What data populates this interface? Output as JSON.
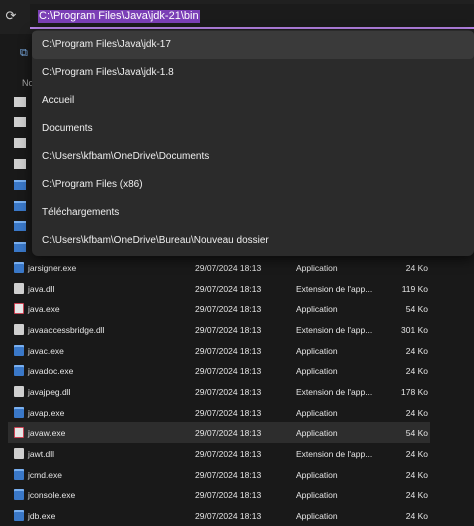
{
  "address_bar": {
    "path": "C:\\Program Files\\Java\\jdk-21\\bin"
  },
  "column_header_partial": "No",
  "suggestions": [
    "C:\\Program Files\\Java\\jdk-17",
    "C:\\Program Files\\Java\\jdk-1.8",
    "Accueil",
    "Documents",
    "C:\\Users\\kfbam\\OneDrive\\Documents",
    "C:\\Program Files (x86)",
    "Téléchargements",
    "C:\\Users\\kfbam\\OneDrive\\Bureau\\Nouveau dossier"
  ],
  "files": [
    {
      "name": "jarsigner.exe",
      "date": "29/07/2024 18:13",
      "type": "Application",
      "size": "24 Ko",
      "icon": "exe"
    },
    {
      "name": "java.dll",
      "date": "29/07/2024 18:13",
      "type": "Extension de l'app...",
      "size": "119 Ko",
      "icon": "dll"
    },
    {
      "name": "java.exe",
      "date": "29/07/2024 18:13",
      "type": "Application",
      "size": "54 Ko",
      "icon": "java"
    },
    {
      "name": "javaaccessbridge.dll",
      "date": "29/07/2024 18:13",
      "type": "Extension de l'app...",
      "size": "301 Ko",
      "icon": "dll"
    },
    {
      "name": "javac.exe",
      "date": "29/07/2024 18:13",
      "type": "Application",
      "size": "24 Ko",
      "icon": "exe"
    },
    {
      "name": "javadoc.exe",
      "date": "29/07/2024 18:13",
      "type": "Application",
      "size": "24 Ko",
      "icon": "exe"
    },
    {
      "name": "javajpeg.dll",
      "date": "29/07/2024 18:13",
      "type": "Extension de l'app...",
      "size": "178 Ko",
      "icon": "dll"
    },
    {
      "name": "javap.exe",
      "date": "29/07/2024 18:13",
      "type": "Application",
      "size": "24 Ko",
      "icon": "exe"
    },
    {
      "name": "javaw.exe",
      "date": "29/07/2024 18:13",
      "type": "Application",
      "size": "54 Ko",
      "icon": "java"
    },
    {
      "name": "jawt.dll",
      "date": "29/07/2024 18:13",
      "type": "Extension de l'app...",
      "size": "24 Ko",
      "icon": "dll"
    },
    {
      "name": "jcmd.exe",
      "date": "29/07/2024 18:13",
      "type": "Application",
      "size": "24 Ko",
      "icon": "exe"
    },
    {
      "name": "jconsole.exe",
      "date": "29/07/2024 18:13",
      "type": "Application",
      "size": "24 Ko",
      "icon": "exe"
    },
    {
      "name": "jdb.exe",
      "date": "29/07/2024 18:13",
      "type": "Application",
      "size": "24 Ko",
      "icon": "exe"
    }
  ],
  "selected_file": "javaw.exe",
  "colors": {
    "accent": "#b784e8",
    "selection_text_bg": "#7b3fb6",
    "exe_icon": "#3a78c8"
  }
}
